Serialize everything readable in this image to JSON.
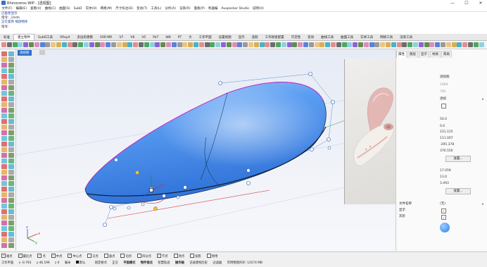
{
  "window": {
    "title": "Rhinoceros WIP - [透视图]",
    "min": "—",
    "max": "☐",
    "close": "✕"
  },
  "menu": [
    "文件(F)",
    "编辑(E)",
    "查看(V)",
    "曲线(C)",
    "曲面(S)",
    "SubD",
    "实体(O)",
    "网格(M)",
    "尺寸标注(D)",
    "变动(T)",
    "工具(L)",
    "分析(A)",
    "渲染(R)",
    "面板(P)",
    "利器编",
    "Auxpecker Studio",
    "说明(H)"
  ],
  "command": {
    "line1": "已复原显示",
    "line2": "指令: _Undo",
    "line3": "正在复原 缩放物体",
    "prompt": "指令:"
  },
  "tabs": [
    "标准",
    "建立物件",
    "SubD工具",
    "VRay4",
    "多边形建模",
    "VSR-MR",
    "V7",
    "V6",
    "V5",
    "PaT",
    "W8",
    "PT",
    "大",
    "工作平面",
    "设置视图",
    "显示",
    "选取",
    "工作视窗配置",
    "可见性",
    "变动",
    "曲线工具",
    "曲面工具",
    "实体工具",
    "网格工具",
    "渲染工具"
  ],
  "active_tab_index": 1,
  "viewport": {
    "label": "透视图",
    "axes": {
      "x": "x",
      "y": "y",
      "z": "z"
    }
  },
  "right_panel": {
    "tabs": [
      "属性",
      "图层",
      "显示",
      "材质",
      "帮助"
    ],
    "properties": [
      {
        "label": "",
        "value": "透视图",
        "dim": false
      },
      {
        "label": "",
        "value": "1484",
        "dim": true
      },
      {
        "label": "",
        "value": "792",
        "dim": true
      },
      {
        "label": "",
        "value": "透视",
        "dim": false
      },
      {
        "label": "",
        "value": "",
        "dim": false
      },
      {
        "label": "",
        "value": "50.0",
        "dim": false
      },
      {
        "label": "",
        "value": "0.0",
        "dim": false
      },
      {
        "label": "",
        "value": "231.125",
        "dim": false
      },
      {
        "label": "",
        "value": "111.007",
        "dim": false
      },
      {
        "label": "",
        "value": "-295.378",
        "dim": false
      },
      {
        "label": "",
        "value": "376.550",
        "dim": false
      }
    ],
    "place_button_1": "放置...",
    "target": [
      "17.059",
      "13.0",
      "3.493"
    ],
    "place_button_2": "放置...",
    "wallpaper": {
      "label": "文件名称",
      "value": "(无)"
    },
    "show": {
      "label": "显示",
      "checked": "✓"
    },
    "gray": {
      "label": "灰阶",
      "checked": "✓"
    }
  },
  "status": {
    "osnaps": [
      "端点",
      "最近点",
      "点",
      "中点",
      "中心点",
      "交点",
      "垂点",
      "切点",
      "四分点",
      "节点",
      "顶点",
      "投影",
      "停用"
    ],
    "osnaps_checked": [
      true,
      true,
      true,
      true,
      true,
      false,
      false,
      false,
      false,
      true,
      false,
      false,
      false
    ],
    "plane": "工作平面",
    "x": "x -0.793",
    "y": "y 46.199",
    "z": "z 0",
    "unit": "毫米",
    "layer": "默认",
    "toggles": [
      "锁定格点",
      "正交",
      "平面模式",
      "物件锁点",
      "智慧轨迹",
      "操作轴",
      "记录建构历史",
      "过滤器"
    ],
    "memory": "可用物理内存: 13574 MB"
  }
}
